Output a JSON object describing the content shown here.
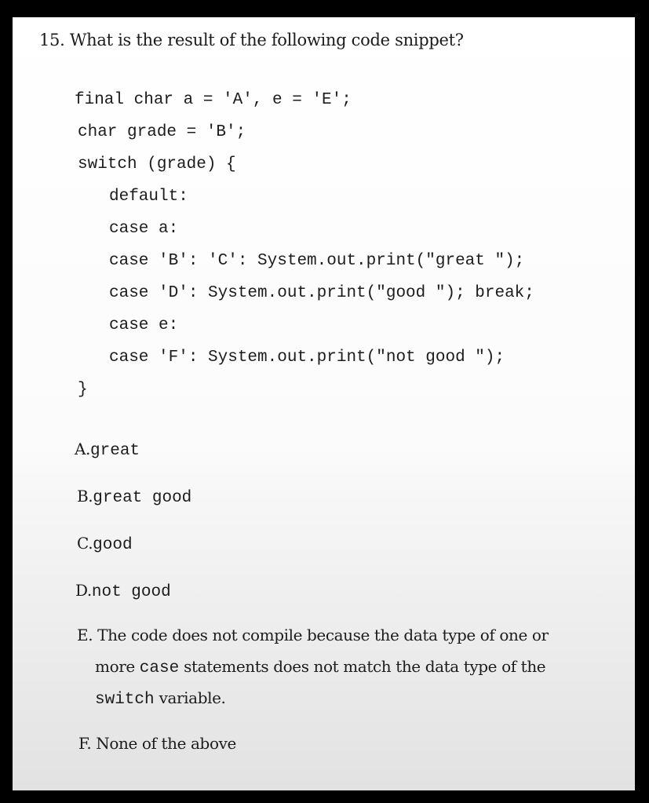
{
  "question": {
    "number": "15.",
    "text": "What is the result of the following code snippet?"
  },
  "code": [
    "final char a = 'A', e = 'E';",
    "char grade = 'B';",
    "switch (grade) {",
    "default:",
    "case a:",
    "case 'B': 'C': System.out.print(\"great \");",
    "case 'D': System.out.print(\"good \"); break;",
    "case e:",
    "case 'F': System.out.print(\"not good \");",
    "}"
  ],
  "options": {
    "a": {
      "letter": "A.",
      "answer": "great"
    },
    "b": {
      "letter": "B.",
      "answer": "great good"
    },
    "c": {
      "letter": "C.",
      "answer": "good"
    },
    "d": {
      "letter": "D.",
      "answer": "not good"
    },
    "e": {
      "letter": "E.",
      "line1": "The code does not compile because the data type of one or",
      "line2_pre": "more",
      "line2_code": "case",
      "line2_post": "statements does not match the data type of the",
      "line3_code": "switch",
      "line3_post": "variable."
    },
    "f": {
      "letter": "F.",
      "text": "None of the above"
    }
  }
}
